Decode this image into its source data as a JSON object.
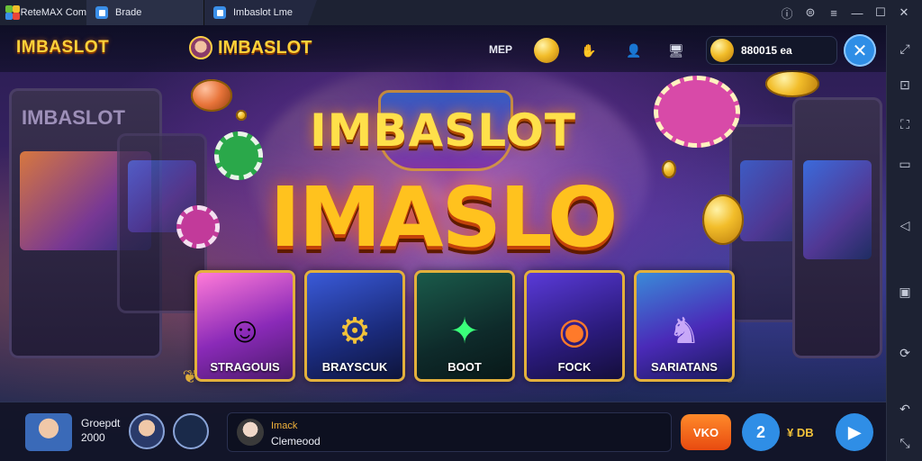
{
  "titlebar": {
    "brand": "ReteMAX Com",
    "tabs": [
      {
        "label": "Brade"
      },
      {
        "label": "Imbaslot Lme"
      }
    ],
    "controls": [
      "help-icon",
      "settings-icon",
      "menu-icon",
      "minimize-icon",
      "maximize-icon",
      "close-icon"
    ]
  },
  "sidebar": {
    "items": [
      "expand-icon",
      "screenshot-icon",
      "resize-icon",
      "window-icon",
      "keyboard-icon",
      "media-icon",
      "rotate-icon",
      "back-icon",
      "fullscreen-icon"
    ]
  },
  "game": {
    "logo_left": "IMBASLOT",
    "logo_center": "IMBASLOT",
    "top_label": "MEP",
    "balance": "880015 ea",
    "title_line1": "IMBASLOT",
    "title_line2": "IMASLO",
    "cards": [
      {
        "label": "STRAGOUIS",
        "icon": "hero-icon",
        "glyph": "☺"
      },
      {
        "label": "BRAYSCUK",
        "icon": "golden-armor-icon",
        "glyph": "⚙"
      },
      {
        "label": "BOOT",
        "icon": "green-gem-icon",
        "glyph": "✦"
      },
      {
        "label": "FOCK",
        "icon": "fire-coin-icon",
        "glyph": "◉"
      },
      {
        "label": "SARIATANS",
        "icon": "rhino-icon",
        "glyph": "♞"
      }
    ]
  },
  "bottom": {
    "player_name": "Groepdt",
    "player_score": "2000",
    "chat_name": "Imack",
    "chat_message": "Clemeood",
    "vip_label": "VKO",
    "circle_label": "2",
    "mini_label": "¥ DB",
    "play_icon": "play-icon"
  },
  "colors": {
    "accent": "#2f8ee6",
    "gold": "#ffc21e",
    "orange": "#e84a10"
  }
}
